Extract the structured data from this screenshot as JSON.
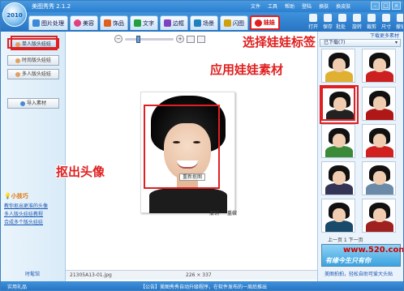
{
  "app": {
    "title": "美图秀秀 2.1.2",
    "logo": "2010"
  },
  "menu": [
    "文件",
    "工具",
    "帮助",
    "登陆",
    "换肤",
    "换皮肤"
  ],
  "tabs": [
    {
      "label": "图片处理",
      "icon": "photo-icon",
      "color": "#3a8ad8"
    },
    {
      "label": "美容",
      "icon": "heart-icon",
      "color": "#e04080"
    },
    {
      "label": "饰品",
      "icon": "gem-icon",
      "color": "#e06020"
    },
    {
      "label": "文字",
      "icon": "text-icon",
      "color": "#20a040"
    },
    {
      "label": "边框",
      "icon": "frame-icon",
      "color": "#8040c0"
    },
    {
      "label": "场景",
      "icon": "scene-icon",
      "color": "#2080c0"
    },
    {
      "label": "闪图",
      "icon": "flash-icon",
      "color": "#d0a010"
    },
    {
      "label": "娃娃",
      "icon": "doll-icon",
      "color": "#e02020"
    }
  ],
  "right_tools": [
    "打开",
    "保存",
    "批处理",
    "旋转",
    "裁剪",
    "尺寸",
    "撤销"
  ],
  "left_panel": {
    "buttons": [
      "单人版头娃娃",
      "时尚版头娃娃",
      "多人版头娃娃"
    ],
    "import_label": "导入素材",
    "tips_title": "小技巧",
    "tips": [
      "教你抠出更准的头像",
      "多人版头娃娃教程",
      "合成多个版头娃娃"
    ],
    "footer": "时髦馆"
  },
  "zoom": {
    "minus": "−",
    "plus": "+"
  },
  "photo_actions": {
    "recrop": "重新抠图",
    "undo": "撤销",
    "redo": "重做"
  },
  "callouts": {
    "select_tab": "选择娃娃标签",
    "apply_material": "应用娃娃素材",
    "crop_head": "抠出头像"
  },
  "status": {
    "filename": "21305A13-01.jpg",
    "dimensions": "226 × 337"
  },
  "right_panel": {
    "header": "下载更多素材",
    "category": "已下载(7)",
    "pager": "上一页 1 下一页",
    "ad_url": "www.520.com",
    "ad_text": "有缘今生只有你",
    "footer": "美图拍拍，轻松自助可爱大头贴"
  },
  "bottom": {
    "left": "实用礼品",
    "notice": "【公告】美图秀秀自动升级程序，在软件发布的一周后推出"
  }
}
